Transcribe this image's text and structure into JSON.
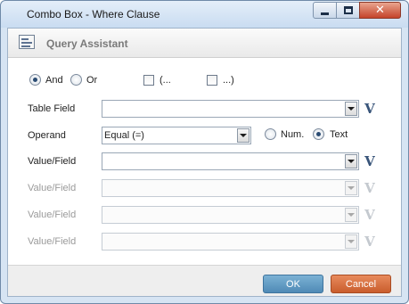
{
  "window": {
    "title": "Combo Box - Where Clause"
  },
  "header": {
    "title": "Query Assistant"
  },
  "logic": {
    "and_label": "And",
    "or_label": "Or",
    "open_paren_label": "(...",
    "close_paren_label": "...)",
    "selected": "And"
  },
  "form": {
    "table_field_label": "Table Field",
    "table_field_value": "",
    "operand_label": "Operand",
    "operand_value": "Equal (=)",
    "num_label": "Num.",
    "text_label": "Text",
    "type_selected": "Text",
    "value_rows": [
      {
        "label": "Value/Field",
        "value": "",
        "enabled": true
      },
      {
        "label": "Value/Field",
        "value": "",
        "enabled": false
      },
      {
        "label": "Value/Field",
        "value": "",
        "enabled": false
      },
      {
        "label": "Value/Field",
        "value": "",
        "enabled": false
      }
    ],
    "v_button_label": "V"
  },
  "footer": {
    "ok_label": "OK",
    "cancel_label": "Cancel"
  },
  "colors": {
    "ok": "#5c97c2",
    "cancel": "#d56a37",
    "v_icon": "#39557a",
    "close": "#c4432a"
  }
}
